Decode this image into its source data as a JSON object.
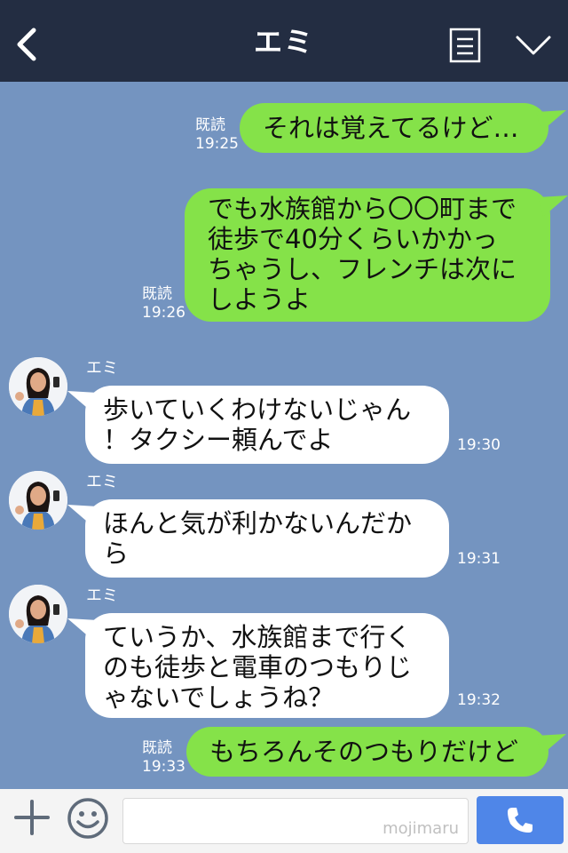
{
  "header": {
    "title": "エミ"
  },
  "messages": [
    {
      "side": "me",
      "lines": "それは覚えてるけど…",
      "read": "既読",
      "time": "19:25"
    },
    {
      "side": "me",
      "lines": "でも水族館から〇〇町まで\n徒歩で40分くらいかかっ\nちゃうし、フレンチは次に\nしようよ",
      "read": "既読",
      "time": "19:26"
    },
    {
      "side": "them",
      "sender": "エミ",
      "lines": "歩いていくわけないじゃん\n！タクシー頼んでよ",
      "time": "19:30"
    },
    {
      "side": "them",
      "sender": "エミ",
      "lines": "ほんと気が利かないんだか\nら",
      "time": "19:31"
    },
    {
      "side": "them",
      "sender": "エミ",
      "lines": "ていうか、水族館まで行く\nのも徒歩と電車のつもりじ\nゃないでしょうね？",
      "time": "19:32"
    },
    {
      "side": "me",
      "lines": "もちろんそのつもりだけど",
      "read": "既読",
      "time": "19:33"
    }
  ],
  "input": {
    "placeholder": "",
    "watermark": "mojimaru"
  },
  "colors": {
    "header": "#232d42",
    "background": "#7494c0",
    "my_bubble": "#85e249",
    "their_bubble": "#ffffff",
    "call_button": "#4f86e8"
  }
}
